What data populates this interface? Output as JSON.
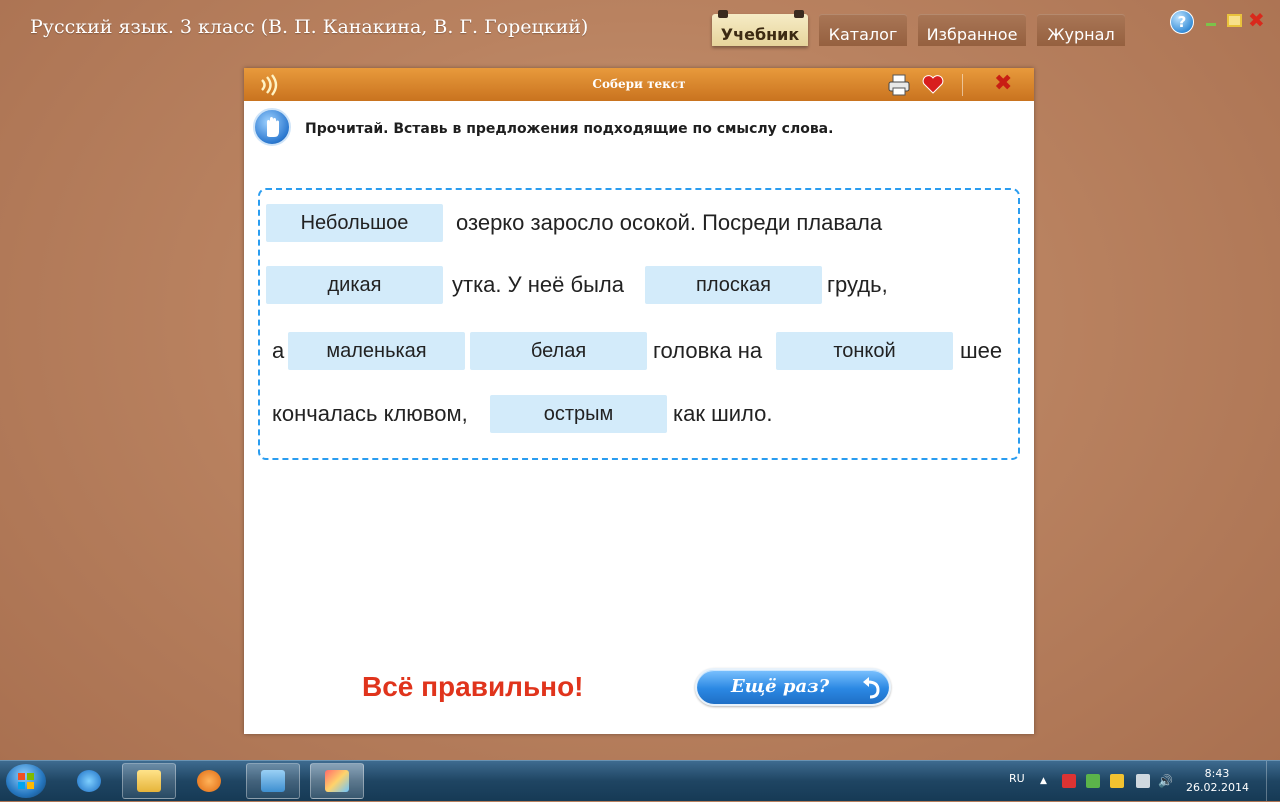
{
  "app": {
    "title": "Русский язык. 3 класс (В. П. Канакина, В. Г. Горецкий)"
  },
  "tabs": [
    {
      "label": "Учебник",
      "active": true
    },
    {
      "label": "Каталог",
      "active": false
    },
    {
      "label": "Избранное",
      "active": false
    },
    {
      "label": "Журнал",
      "active": false
    }
  ],
  "window_controls": {
    "help": "?"
  },
  "dialog": {
    "title": "Собери текст",
    "instruction": "Прочитай. Вставь в предложения подходящие по смыслу слова.",
    "lines": [
      {
        "slot1": "Небольшое",
        "text1": "озерко заросло осокой. Посреди плавала"
      },
      {
        "slot1": "дикая",
        "text1": "утка. У неё была",
        "slot2": "плоская",
        "text2": "грудь,"
      },
      {
        "text0": "а",
        "slot1": "маленькая",
        "slot2": "белая",
        "text1": "головка на",
        "slot3": "тонкой",
        "text2": "шее"
      },
      {
        "text0": "кончалась клювом,",
        "slot1": "острым",
        "text1": "как шило."
      }
    ],
    "result": "Всё правильно!",
    "again_button": "Ещё раз?"
  },
  "icons": {
    "sound": "sound-icon",
    "print": "printer-icon",
    "favorite": "heart-icon",
    "close": "close-icon",
    "hint": "hand-icon",
    "repeat": "return-arrow-icon"
  },
  "colors": {
    "header": "#d9822b",
    "slot": "#d3ebfa",
    "result": "#e0341c",
    "dashed_border": "#2a9df0"
  },
  "taskbar": {
    "language": "RU",
    "time": "8:43",
    "date": "26.02.2014"
  }
}
